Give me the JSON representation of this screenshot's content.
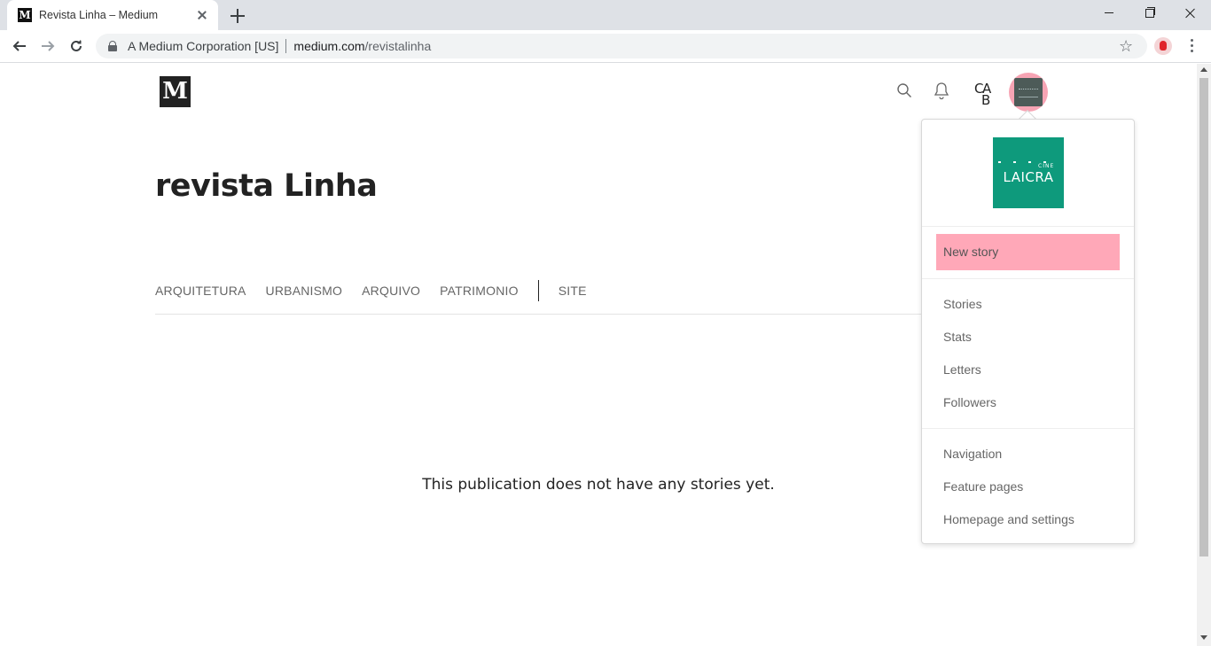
{
  "browser": {
    "tab_title": "Revista Linha – Medium",
    "favicon_letter": "M",
    "org_label": "A Medium Corporation [US]",
    "url_host": "medium.com",
    "url_path": "/revistalinha"
  },
  "header": {
    "logo_letter": "M",
    "cab_text": "CAB"
  },
  "publication": {
    "title": "revista Linha",
    "nav": [
      "ARQUITETURA",
      "URBANISMO",
      "ARQUIVO",
      "PATRIMONIO"
    ],
    "nav_external": "SITE",
    "empty_message": "This publication does not have any stories yet."
  },
  "menu": {
    "logo_word": "LAICRA",
    "logo_small": "CINE",
    "new_story": "New story",
    "group1": [
      "Stories",
      "Stats",
      "Letters",
      "Followers"
    ],
    "group2": [
      "Navigation",
      "Feature pages",
      "Homepage and settings"
    ]
  },
  "colors": {
    "highlight": "#ffa8b8",
    "avatar_ring": "#f7a4b4",
    "logo_green": "#0e9a7c"
  }
}
